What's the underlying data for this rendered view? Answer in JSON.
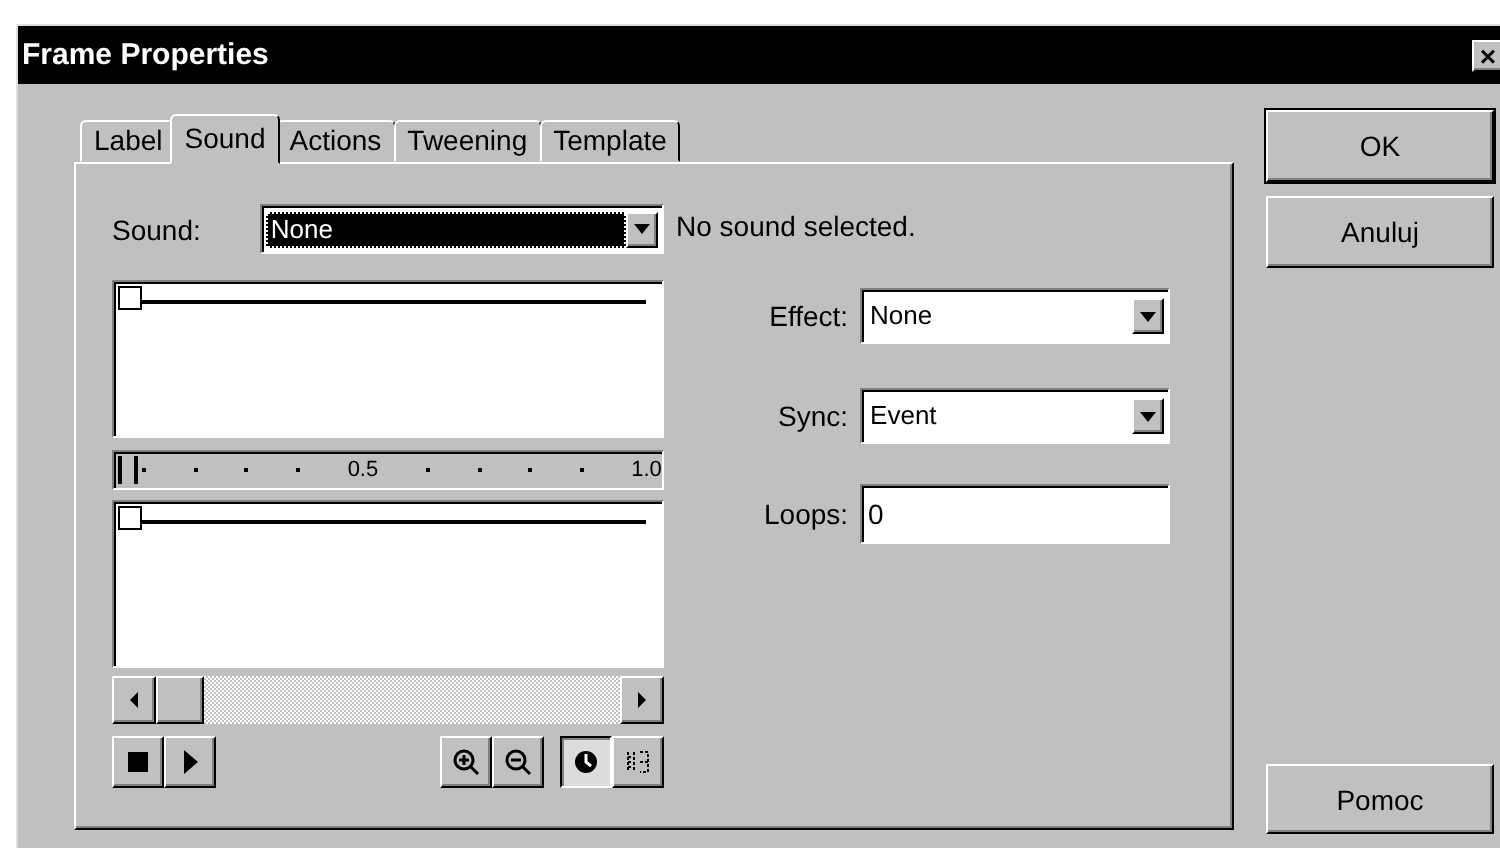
{
  "window": {
    "title": "Frame Properties",
    "close": "×"
  },
  "tabs": [
    {
      "label": "Label",
      "selected": false
    },
    {
      "label": "Sound",
      "selected": true
    },
    {
      "label": "Actions",
      "selected": false
    },
    {
      "label": "Tweening",
      "selected": false
    },
    {
      "label": "Template",
      "selected": false
    }
  ],
  "sound": {
    "label": "Sound:",
    "value": "None",
    "focused": true,
    "status": "No sound selected."
  },
  "ruler": {
    "labels": [
      "0.5",
      "1.0"
    ]
  },
  "transport": [
    {
      "kind": "stop"
    },
    {
      "kind": "play"
    }
  ],
  "view_tools": [
    {
      "kind": "zoom-in",
      "selected": false
    },
    {
      "kind": "zoom-out",
      "selected": false
    },
    {
      "kind": "seconds",
      "selected": true
    },
    {
      "kind": "frames",
      "selected": false
    }
  ],
  "effect": {
    "label": "Effect:",
    "value": "None"
  },
  "sync": {
    "label": "Sync:",
    "value": "Event"
  },
  "loops": {
    "label": "Loops:",
    "value": "0"
  },
  "buttons": [
    {
      "label": "OK",
      "default": true
    },
    {
      "label": "Anuluj",
      "default": false
    },
    {
      "label": "Pomoc",
      "default": false
    }
  ]
}
